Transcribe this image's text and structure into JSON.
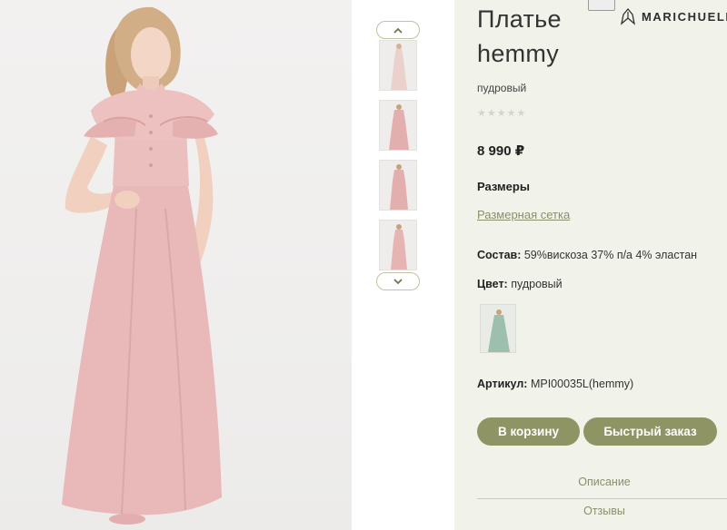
{
  "product": {
    "title_line1": "Платье",
    "title_line2": "hemmy",
    "color_subtitle": "пудровый",
    "rating_stars": "★★★★★",
    "rating_value": 0,
    "price": "8 990 ₽"
  },
  "brand": {
    "name": "MARICHUELL"
  },
  "sizes": {
    "label": "Размеры",
    "chart_link": "Размерная сетка"
  },
  "composition": {
    "label": "Состав:",
    "value": "59%вискоза 37% п/а 4% эластан"
  },
  "color": {
    "label": "Цвет:",
    "value": "пудровый"
  },
  "article": {
    "label": "Артикул:",
    "value": "MPI00035L(hemmy)"
  },
  "buttons": {
    "add_to_cart": "В корзину",
    "quick_order": "Быстрый заказ"
  },
  "tabs": {
    "description": "Описание",
    "reviews": "Отзывы"
  },
  "colors": {
    "accent": "#8f9464",
    "panel_bg": "#f1f2ea",
    "dress": "#e8b9b8",
    "link": "#8a8f6a"
  },
  "icons": {
    "thumb_up": "chevron-up-icon",
    "thumb_down": "chevron-down-icon"
  }
}
